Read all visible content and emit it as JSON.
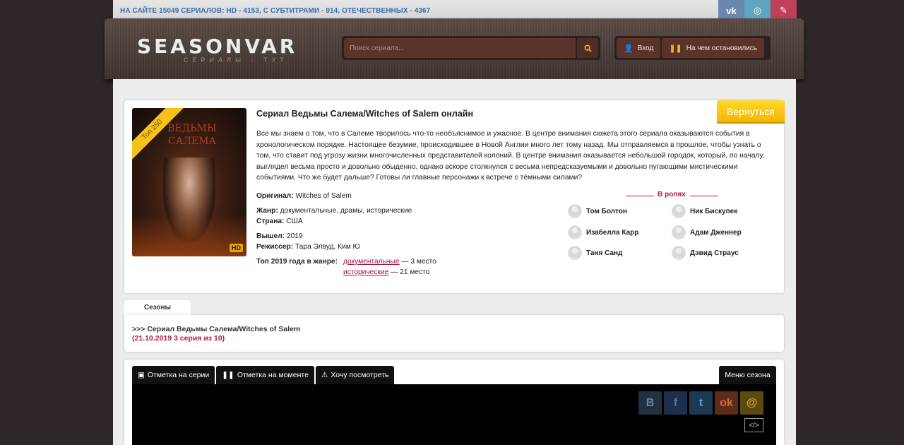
{
  "topbar": {
    "prefix": "НА САЙТЕ",
    "total": "15049",
    "text1": "СЕРИАЛОВ: HD -",
    "hd": "4153",
    "text2": ", С СУБТИТРАМИ -",
    "subs": "914",
    "text3": ", ОТЕЧЕСТВЕННЫХ -",
    "domestic": "4367"
  },
  "social_top": {
    "vk": "vk",
    "ok": "ok",
    "other": "x"
  },
  "logo": {
    "text": "SEASONVAR",
    "subtitle": "СЕРИАЛЫ · ТУТ"
  },
  "search": {
    "placeholder": "Поиск сериала..."
  },
  "auth": {
    "login": "Вход",
    "continue": "На чем остановились"
  },
  "card": {
    "title": "Сериал Ведьмы Салема/Witches of Salem онлайн",
    "back_button": "Вернуться",
    "poster": {
      "title": "ВЕДЬМЫ САЛЕМА",
      "ribbon": "Топ 250",
      "badge": "HD"
    },
    "description": "Все мы знаем о том, что в Салеме творилось что-то необъяснимое и ужасное. В центре внимания сюжета этого сериала оказываются события в хронологическом порядке. Настоящее безумие, происходившее в Новой Англии много лет тому назад. Мы отправляемся в прошлое, чтобы узнать о том, что ставит под угрозу жизни многочисленных представителей колоний. В центре внимания оказывается небольшой городок, который, по началу, выглядел весьма просто и довольно обыденно, однако вскоре столкнулся с весьма непредсказуемыми и довольно пугающими мистическими событиями. Что же будет дальше? Готовы ли главные персонажи к встрече с тёмными силами?",
    "info": {
      "original_label": "Оригинал:",
      "original": "Witches of Salem",
      "genre_label": "Жанр:",
      "genre": "документальные, драмы, исторические",
      "country_label": "Страна:",
      "country": "США",
      "year_label": "Вышел:",
      "year": "2019",
      "director_label": "Режиссер:",
      "director": "Тара Элвуд, Ким Ю",
      "top_label": "Топ 2019 года в жанре:",
      "top": [
        {
          "genre": "документальные",
          "place": "— 3 место"
        },
        {
          "genre": "исторические",
          "place": "— 21 место"
        }
      ]
    },
    "cast": {
      "title": "В ролях",
      "actors": [
        "Том Болтон",
        "Ник Бискупек",
        "Изабелла Карр",
        "Адам Дженнер",
        "Таня Санд",
        "Дэвид Страус"
      ]
    }
  },
  "seasons": {
    "tab": "Сезоны",
    "link": ">>> Сериал Ведьмы Салема/Witches of Salem",
    "date": "(21.10.2019 3 серия из 10)"
  },
  "player": {
    "tabs": [
      "Отметка на серии",
      "Отметка на моменте",
      "Хочу посмотреть"
    ],
    "menu": "Меню сезона",
    "share": [
      "B",
      "f",
      "t",
      "ok",
      "@"
    ],
    "embed": "</>"
  },
  "colors": {
    "accent": "#b01a45",
    "back_button": "#f6c21a",
    "header": "#4a3c37"
  }
}
